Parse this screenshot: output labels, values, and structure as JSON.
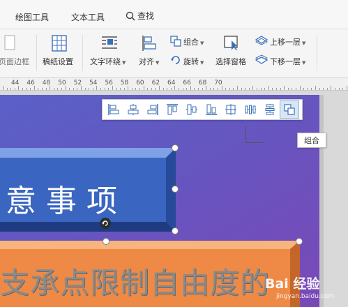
{
  "tabs": {
    "drawing_tools": "绘图工具",
    "text_tools": "文本工具",
    "search": "查找"
  },
  "ribbon": {
    "page_border": "页面边框",
    "paper_settings": "稿纸设置",
    "text_wrap": "文字环绕",
    "align": "对齐",
    "group": "组合",
    "rotate": "旋转",
    "selection_pane": "选择窗格",
    "bring_forward": "上移一层",
    "send_backward": "下移一层"
  },
  "ruler": {
    "numbers": [
      "44",
      "46",
      "48",
      "50",
      "52",
      "54",
      "56",
      "58",
      "60",
      "62",
      "64",
      "66",
      "68",
      "70"
    ]
  },
  "tooltip": "组合",
  "slide": {
    "blue_text": "意事项",
    "orange_text": "支承点限制自由度的"
  },
  "watermark": {
    "logo": "Bai 经验",
    "url": "jingyan.baidu.com"
  },
  "colors": {
    "page_purple": "#6457c0",
    "blue_button": "#3a66c2",
    "orange_button": "#ee8a46",
    "active_button": "#d9e6f5"
  }
}
